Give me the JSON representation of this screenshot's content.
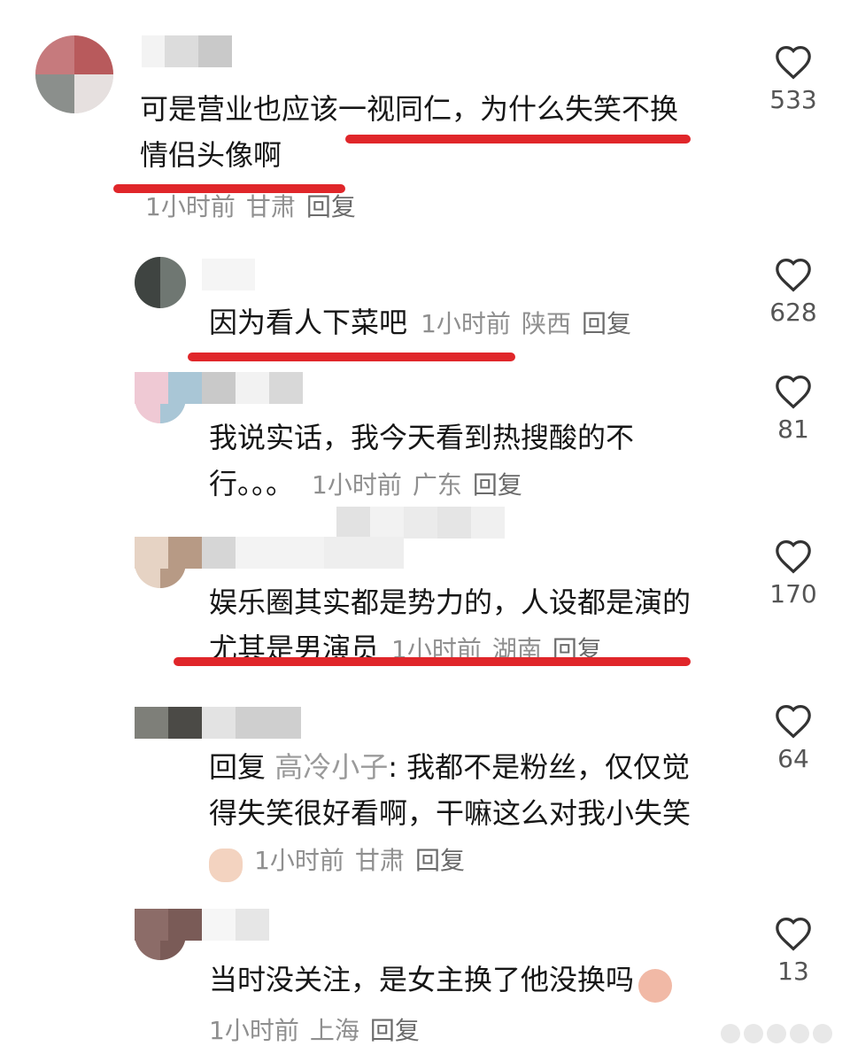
{
  "comments": [
    {
      "text_lines": [
        "可是营业也应该一视同仁，为什么失笑不换",
        "情侣头像啊"
      ],
      "time": "1小时前",
      "location": "甘肃",
      "reply": "回复",
      "likes": "533"
    },
    {
      "text_lines": [
        "因为看人下菜吧"
      ],
      "time": "1小时前",
      "location": "陕西",
      "reply": "回复",
      "likes": "628"
    },
    {
      "text_lines": [
        "我说实话，我今天看到热搜酸的不",
        "行。。。"
      ],
      "time": "1小时前",
      "location": "广东",
      "reply": "回复",
      "likes": "81"
    },
    {
      "text_lines": [
        "娱乐圈其实都是势力的，人设都是演的",
        "尤其是男演员"
      ],
      "time": "1小时前",
      "location": "湖南",
      "reply": "回复",
      "likes": "170"
    },
    {
      "reply_prefix": "回复",
      "reply_to": "高冷小子",
      "text_lines": [
        "我都不是粉丝，仅仅觉",
        "得失笑很好看啊，干嘛这么对我小失笑"
      ],
      "time": "1小时前",
      "location": "甘肃",
      "reply": "回复",
      "likes": "64",
      "emoji": "sly-face-emoji"
    },
    {
      "text_lines": [
        "当时没关注，是女主换了他没换吗"
      ],
      "time": "1小时前",
      "location": "上海",
      "reply": "回复",
      "likes": "13",
      "emoji": "crying-laughing-emoji"
    }
  ],
  "icons": {
    "like": "heart-outline-icon"
  },
  "colors": {
    "underline": "#e0262a",
    "meta": "#8f8f8f",
    "text": "#161616"
  }
}
